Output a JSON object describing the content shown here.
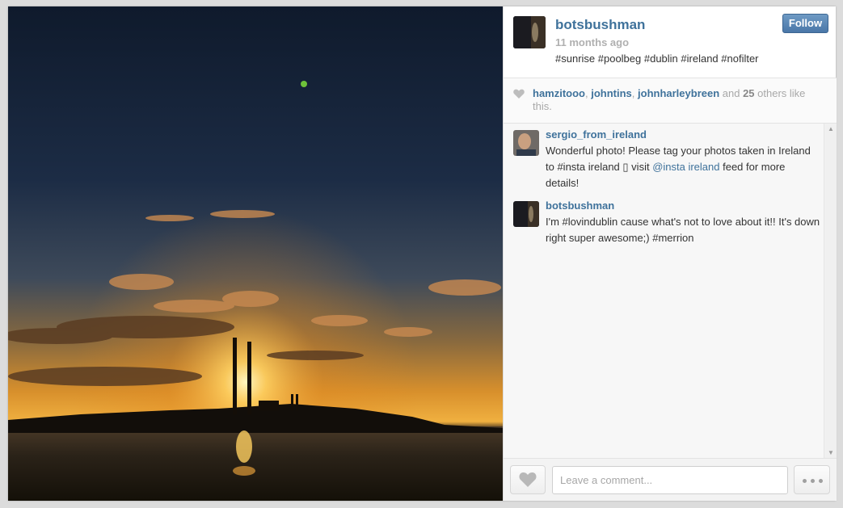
{
  "post": {
    "username": "botsbushman",
    "time_ago": "11 months ago",
    "caption": "#sunrise #poolbeg #dublin #ireland #nofilter",
    "follow_label": "Follow"
  },
  "likes": {
    "users": [
      "hamzitooo",
      "johntins",
      "johnharleybreen"
    ],
    "sep1": ", ",
    "sep2": ", ",
    "and_text": " and ",
    "others_count": "25",
    "others_text": " others like this."
  },
  "comments": [
    {
      "user": "sergio_from_ireland",
      "text_before": "Wonderful photo! Please tag your photos taken in Ireland to #insta  ireland ",
      "glyph": "▯",
      "text_mid": " visit ",
      "mention": "@insta  ireland",
      "text_after": " feed for more details!"
    },
    {
      "user": "botsbushman",
      "text": "I'm #lovindublin cause what's not to love about it!! It's down right super awesome;) #merrion"
    }
  ],
  "footer": {
    "comment_placeholder": "Leave a comment..."
  },
  "icons": {
    "heart": "heart-icon",
    "more": "more-dots-icon",
    "scroll_up": "scroll-up-arrow-icon",
    "scroll_down": "scroll-down-arrow-icon"
  },
  "colors": {
    "link": "#3f729b",
    "follow_button": "#517fa4"
  }
}
